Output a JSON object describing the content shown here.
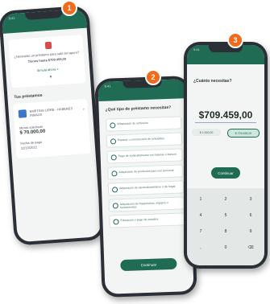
{
  "badges": [
    "1",
    "2",
    "3"
  ],
  "phone1": {
    "status": "9:41",
    "question": "¿Necesitas un préstamo para salir del apuro?",
    "amount_line": "Tienes hasta $709.459,00",
    "link": "Simula ahora >",
    "section": "Tus préstamos",
    "loan_name": "EMPTING LIBRE - HABERES INMAZA",
    "loan_label": "Monto solicitado",
    "loan_amount": "$ 70.000,00",
    "date_label": "Fecha de pago",
    "date": "12/10/2022"
  },
  "phone2": {
    "status": "9:41",
    "title": "¿Qué tipo de préstamo necesitas?",
    "options": [
      "Adquisición de vehículos",
      "Reparar o construcción de inmuebles",
      "Pago de endeudamiento con tarjetas o bancos",
      "Adquisición de productos para uso personal",
      "Adquisición de electrodomésticos o de hogar",
      "Adquisición de maquinarias, equipos o herramientas",
      "Educación o pago de estudios"
    ],
    "button": "Continuar"
  },
  "phone3": {
    "status": "9:41",
    "title": "¿Cuánto necesitas?",
    "amount": "$709.459,00",
    "chip_left": "$ 1.000,00",
    "chip_right": "$ 709.459,00",
    "button": "Continuar",
    "keys": [
      "1",
      "2",
      "3",
      "4",
      "5",
      "6",
      "7",
      "8",
      "9",
      ",",
      "0",
      "⌫"
    ]
  }
}
